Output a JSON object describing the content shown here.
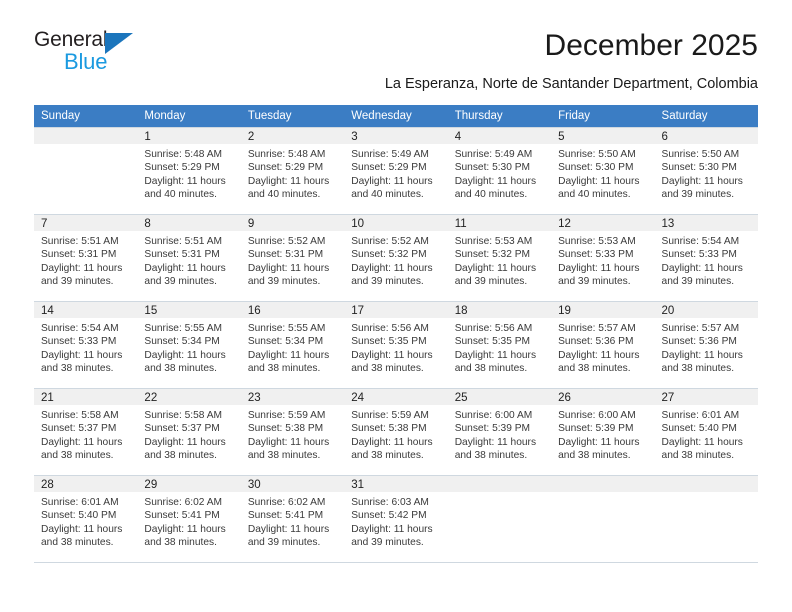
{
  "brand": {
    "name_top": "General",
    "name_bottom": "Blue",
    "triangle_color": "#1b75bc",
    "blue_color": "#1b9ae0"
  },
  "header": {
    "title": "December 2025",
    "subtitle": "La Esperanza, Norte de Santander Department, Colombia"
  },
  "theme": {
    "header_bg": "#3b7dc4",
    "header_text": "#ffffff",
    "daynum_bg": "#f0f0f0",
    "grid_line": "#cfd8e0"
  },
  "calendar": {
    "weekdays": [
      "Sunday",
      "Monday",
      "Tuesday",
      "Wednesday",
      "Thursday",
      "Friday",
      "Saturday"
    ],
    "labels": {
      "sunrise_prefix": "Sunrise:",
      "sunset_prefix": "Sunset:",
      "daylight_prefix": "Daylight:"
    },
    "weeks": [
      [
        {
          "day": "",
          "sunrise": "",
          "sunset": "",
          "daylight": "",
          "empty": true
        },
        {
          "day": "1",
          "sunrise": "Sunrise: 5:48 AM",
          "sunset": "Sunset: 5:29 PM",
          "daylight": "Daylight: 11 hours and 40 minutes."
        },
        {
          "day": "2",
          "sunrise": "Sunrise: 5:48 AM",
          "sunset": "Sunset: 5:29 PM",
          "daylight": "Daylight: 11 hours and 40 minutes."
        },
        {
          "day": "3",
          "sunrise": "Sunrise: 5:49 AM",
          "sunset": "Sunset: 5:29 PM",
          "daylight": "Daylight: 11 hours and 40 minutes."
        },
        {
          "day": "4",
          "sunrise": "Sunrise: 5:49 AM",
          "sunset": "Sunset: 5:30 PM",
          "daylight": "Daylight: 11 hours and 40 minutes."
        },
        {
          "day": "5",
          "sunrise": "Sunrise: 5:50 AM",
          "sunset": "Sunset: 5:30 PM",
          "daylight": "Daylight: 11 hours and 40 minutes."
        },
        {
          "day": "6",
          "sunrise": "Sunrise: 5:50 AM",
          "sunset": "Sunset: 5:30 PM",
          "daylight": "Daylight: 11 hours and 39 minutes."
        }
      ],
      [
        {
          "day": "7",
          "sunrise": "Sunrise: 5:51 AM",
          "sunset": "Sunset: 5:31 PM",
          "daylight": "Daylight: 11 hours and 39 minutes."
        },
        {
          "day": "8",
          "sunrise": "Sunrise: 5:51 AM",
          "sunset": "Sunset: 5:31 PM",
          "daylight": "Daylight: 11 hours and 39 minutes."
        },
        {
          "day": "9",
          "sunrise": "Sunrise: 5:52 AM",
          "sunset": "Sunset: 5:31 PM",
          "daylight": "Daylight: 11 hours and 39 minutes."
        },
        {
          "day": "10",
          "sunrise": "Sunrise: 5:52 AM",
          "sunset": "Sunset: 5:32 PM",
          "daylight": "Daylight: 11 hours and 39 minutes."
        },
        {
          "day": "11",
          "sunrise": "Sunrise: 5:53 AM",
          "sunset": "Sunset: 5:32 PM",
          "daylight": "Daylight: 11 hours and 39 minutes."
        },
        {
          "day": "12",
          "sunrise": "Sunrise: 5:53 AM",
          "sunset": "Sunset: 5:33 PM",
          "daylight": "Daylight: 11 hours and 39 minutes."
        },
        {
          "day": "13",
          "sunrise": "Sunrise: 5:54 AM",
          "sunset": "Sunset: 5:33 PM",
          "daylight": "Daylight: 11 hours and 39 minutes."
        }
      ],
      [
        {
          "day": "14",
          "sunrise": "Sunrise: 5:54 AM",
          "sunset": "Sunset: 5:33 PM",
          "daylight": "Daylight: 11 hours and 38 minutes."
        },
        {
          "day": "15",
          "sunrise": "Sunrise: 5:55 AM",
          "sunset": "Sunset: 5:34 PM",
          "daylight": "Daylight: 11 hours and 38 minutes."
        },
        {
          "day": "16",
          "sunrise": "Sunrise: 5:55 AM",
          "sunset": "Sunset: 5:34 PM",
          "daylight": "Daylight: 11 hours and 38 minutes."
        },
        {
          "day": "17",
          "sunrise": "Sunrise: 5:56 AM",
          "sunset": "Sunset: 5:35 PM",
          "daylight": "Daylight: 11 hours and 38 minutes."
        },
        {
          "day": "18",
          "sunrise": "Sunrise: 5:56 AM",
          "sunset": "Sunset: 5:35 PM",
          "daylight": "Daylight: 11 hours and 38 minutes."
        },
        {
          "day": "19",
          "sunrise": "Sunrise: 5:57 AM",
          "sunset": "Sunset: 5:36 PM",
          "daylight": "Daylight: 11 hours and 38 minutes."
        },
        {
          "day": "20",
          "sunrise": "Sunrise: 5:57 AM",
          "sunset": "Sunset: 5:36 PM",
          "daylight": "Daylight: 11 hours and 38 minutes."
        }
      ],
      [
        {
          "day": "21",
          "sunrise": "Sunrise: 5:58 AM",
          "sunset": "Sunset: 5:37 PM",
          "daylight": "Daylight: 11 hours and 38 minutes."
        },
        {
          "day": "22",
          "sunrise": "Sunrise: 5:58 AM",
          "sunset": "Sunset: 5:37 PM",
          "daylight": "Daylight: 11 hours and 38 minutes."
        },
        {
          "day": "23",
          "sunrise": "Sunrise: 5:59 AM",
          "sunset": "Sunset: 5:38 PM",
          "daylight": "Daylight: 11 hours and 38 minutes."
        },
        {
          "day": "24",
          "sunrise": "Sunrise: 5:59 AM",
          "sunset": "Sunset: 5:38 PM",
          "daylight": "Daylight: 11 hours and 38 minutes."
        },
        {
          "day": "25",
          "sunrise": "Sunrise: 6:00 AM",
          "sunset": "Sunset: 5:39 PM",
          "daylight": "Daylight: 11 hours and 38 minutes."
        },
        {
          "day": "26",
          "sunrise": "Sunrise: 6:00 AM",
          "sunset": "Sunset: 5:39 PM",
          "daylight": "Daylight: 11 hours and 38 minutes."
        },
        {
          "day": "27",
          "sunrise": "Sunrise: 6:01 AM",
          "sunset": "Sunset: 5:40 PM",
          "daylight": "Daylight: 11 hours and 38 minutes."
        }
      ],
      [
        {
          "day": "28",
          "sunrise": "Sunrise: 6:01 AM",
          "sunset": "Sunset: 5:40 PM",
          "daylight": "Daylight: 11 hours and 38 minutes."
        },
        {
          "day": "29",
          "sunrise": "Sunrise: 6:02 AM",
          "sunset": "Sunset: 5:41 PM",
          "daylight": "Daylight: 11 hours and 38 minutes."
        },
        {
          "day": "30",
          "sunrise": "Sunrise: 6:02 AM",
          "sunset": "Sunset: 5:41 PM",
          "daylight": "Daylight: 11 hours and 39 minutes."
        },
        {
          "day": "31",
          "sunrise": "Sunrise: 6:03 AM",
          "sunset": "Sunset: 5:42 PM",
          "daylight": "Daylight: 11 hours and 39 minutes."
        },
        {
          "day": "",
          "sunrise": "",
          "sunset": "",
          "daylight": "",
          "empty": true
        },
        {
          "day": "",
          "sunrise": "",
          "sunset": "",
          "daylight": "",
          "empty": true
        },
        {
          "day": "",
          "sunrise": "",
          "sunset": "",
          "daylight": "",
          "empty": true
        }
      ]
    ]
  }
}
